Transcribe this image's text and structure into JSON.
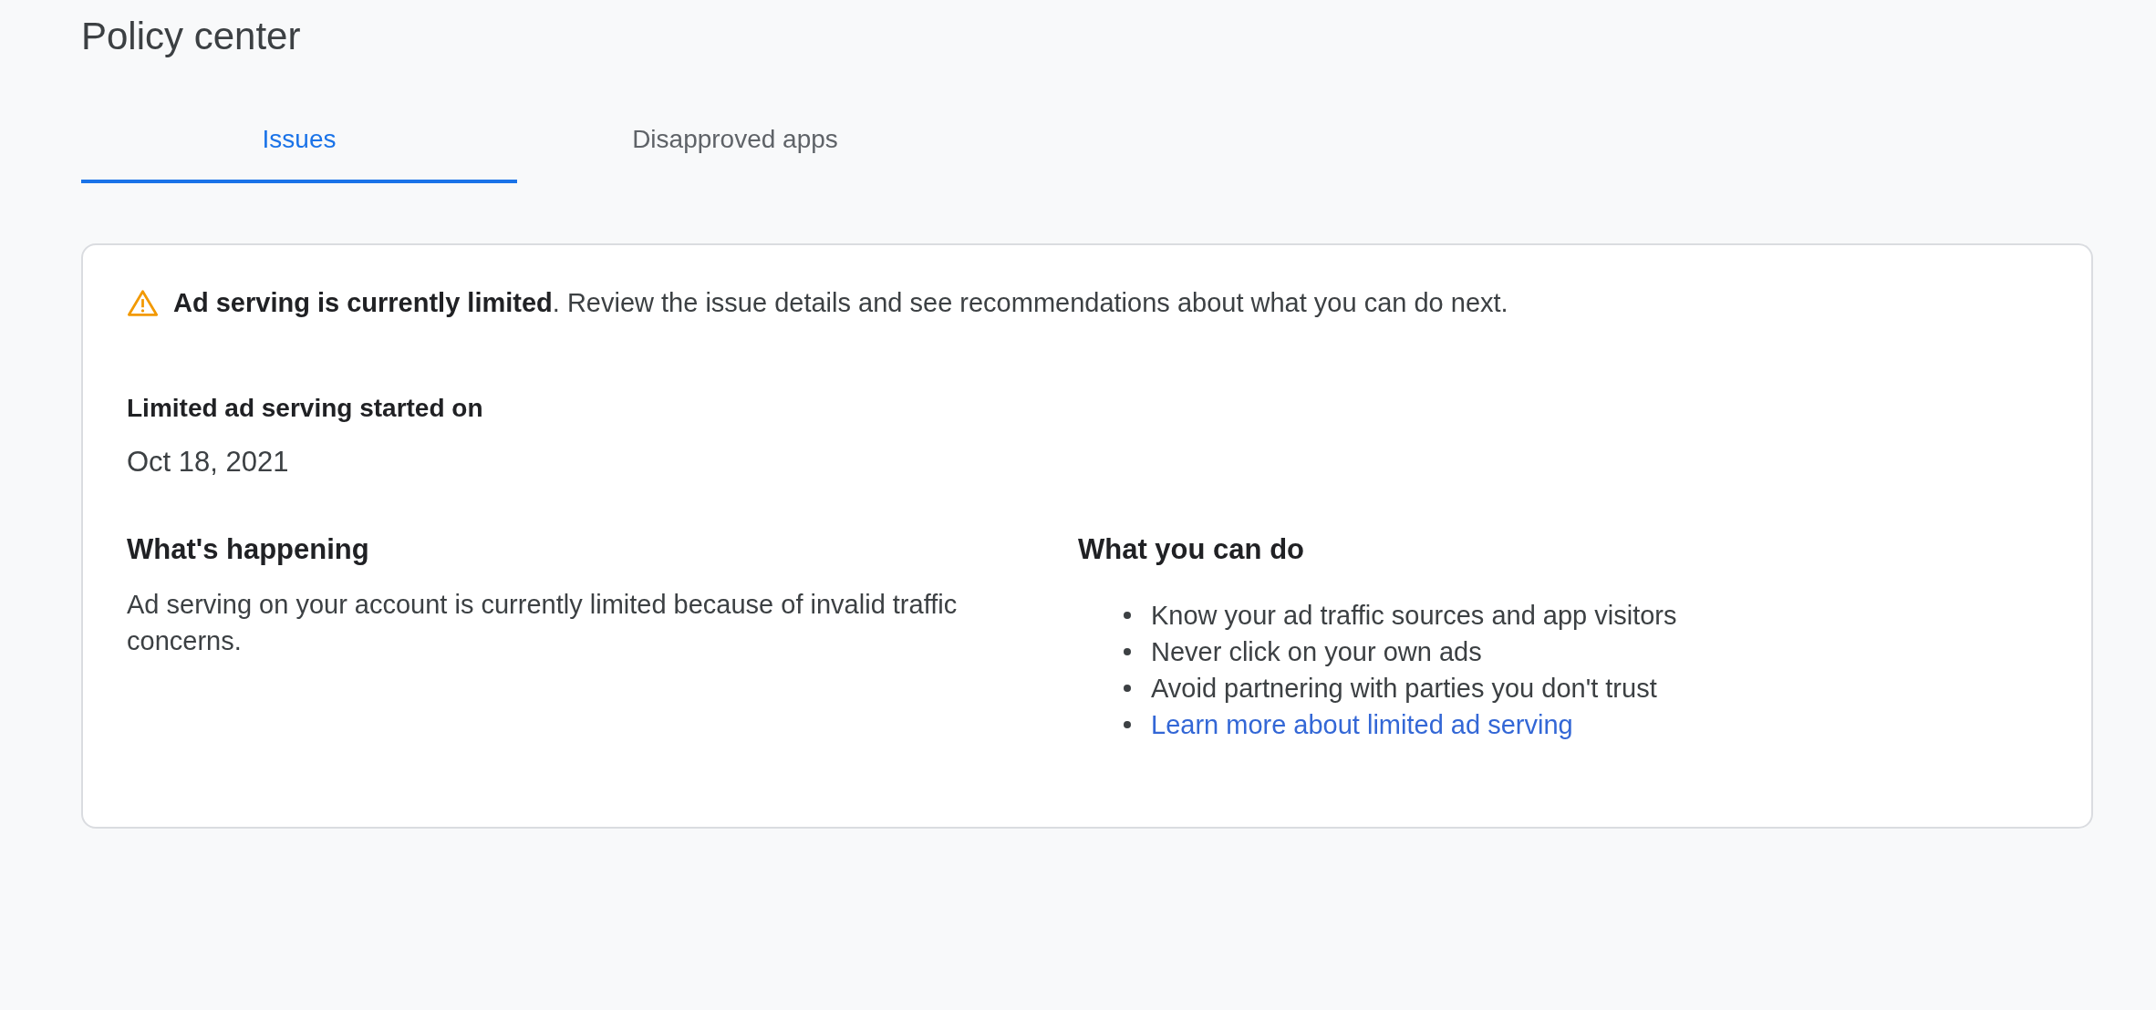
{
  "page": {
    "title": "Policy center"
  },
  "tabs": [
    {
      "label": "Issues",
      "selected": true
    },
    {
      "label": "Disapproved apps",
      "selected": false
    }
  ],
  "issue_card": {
    "alert": {
      "kind": "warning",
      "text": "**Ad serving is currently limited**. Review the issue details and see recommendations about what you can do next."
    },
    "start_date": {
      "label": "Limited ad serving started on",
      "value": "Oct 18, 2021"
    },
    "whats_happening": {
      "heading": "What's happening",
      "text": "Ad serving on your account is currently limited because of invalid traffic concerns."
    },
    "what_you_can_do": {
      "heading": "What you can do",
      "items": [
        {
          "kind": "text",
          "text": "Know your ad traffic sources and app visitors"
        },
        {
          "kind": "text",
          "text": "Never click on your own ads"
        },
        {
          "kind": "text",
          "text": "Avoid partnering with parties you don't trust"
        },
        {
          "kind": "link",
          "text": "Learn more about limited ad serving"
        }
      ]
    }
  }
}
